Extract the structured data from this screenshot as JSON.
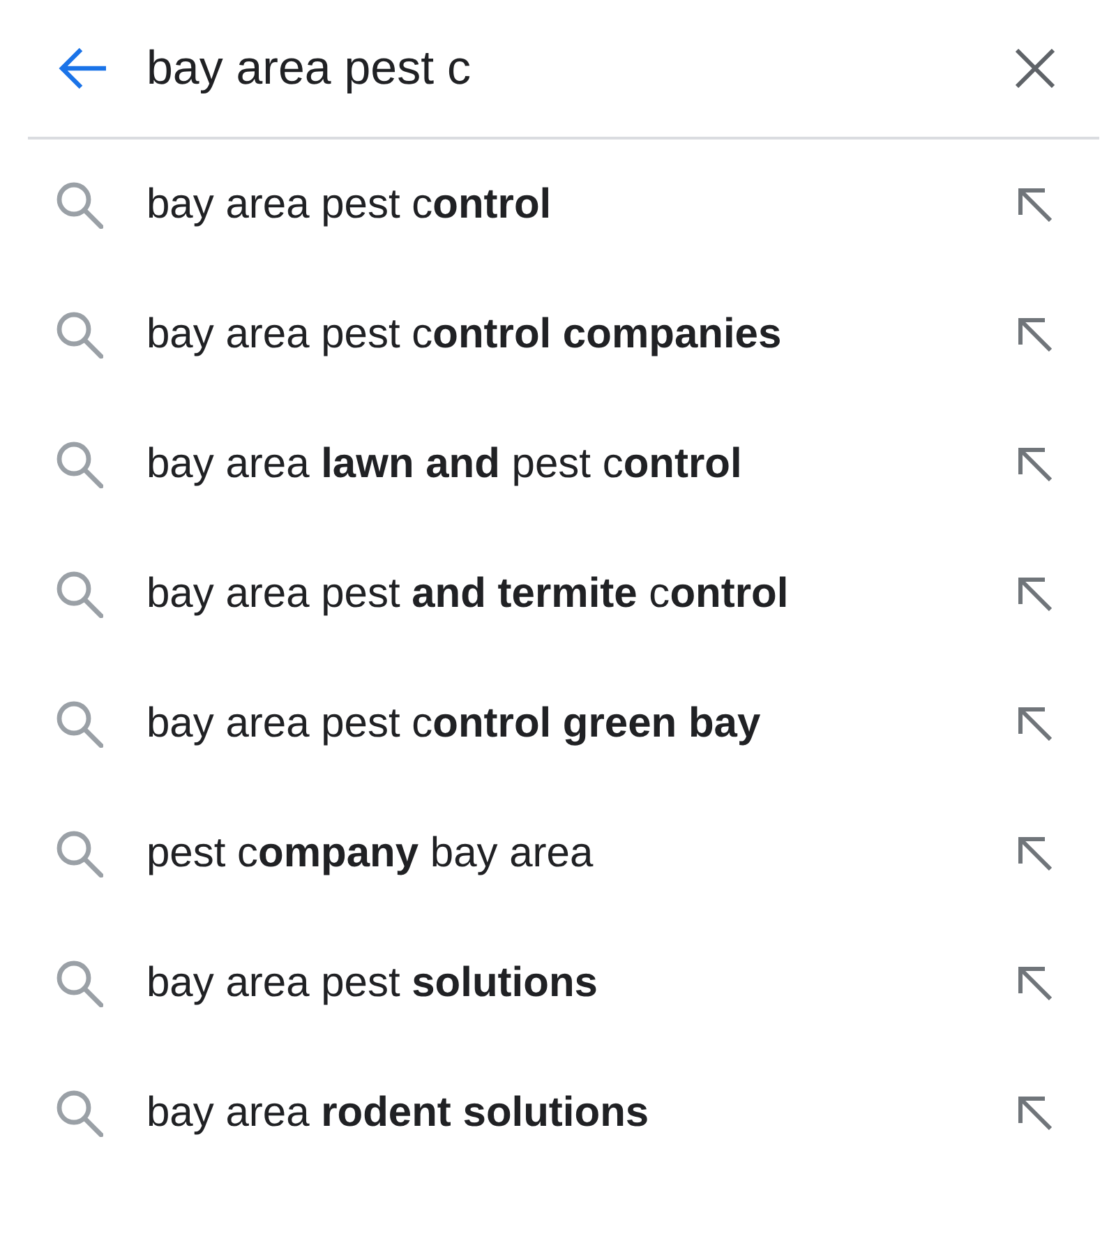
{
  "search": {
    "value": "bay area pest c"
  },
  "suggestions": [
    {
      "text": "bay area pest c**ontrol**"
    },
    {
      "text": "bay area pest c**ontrol companies**"
    },
    {
      "text": "bay area **lawn and** pest c**ontrol**"
    },
    {
      "text": "bay area pest **and termite** c**ontrol**"
    },
    {
      "text": "bay area pest c**ontrol green bay**"
    },
    {
      "text": "pest c**ompany** bay area"
    },
    {
      "text": "bay area pest **solutions**"
    },
    {
      "text": "bay area **rodent solutions**"
    }
  ]
}
